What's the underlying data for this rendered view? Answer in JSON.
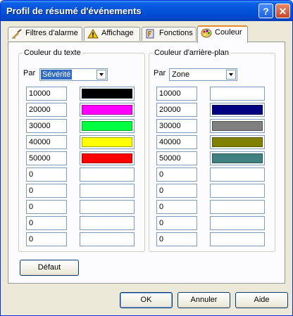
{
  "window": {
    "title": "Profil de résumé d'événements",
    "help_label": "?",
    "close_label": "✕"
  },
  "tabs": [
    {
      "label": "Filtres d'alarme",
      "icon": "filter-broom-icon",
      "active": false
    },
    {
      "label": "Affichage",
      "icon": "display-warning-icon",
      "active": false
    },
    {
      "label": "Fonctions",
      "icon": "functions-icon",
      "active": false
    },
    {
      "label": "Couleur",
      "icon": "palette-icon",
      "active": true
    }
  ],
  "text_color": {
    "title": "Couleur du texte",
    "par_label": "Par",
    "combo_value": "Sévérité",
    "rows": [
      {
        "value": "10000",
        "color": "#000000"
      },
      {
        "value": "20000",
        "color": "#ff00ff"
      },
      {
        "value": "30000",
        "color": "#00ff40"
      },
      {
        "value": "40000",
        "color": "#ffff00"
      },
      {
        "value": "50000",
        "color": "#ff0000"
      },
      {
        "value": "0",
        "color": ""
      },
      {
        "value": "0",
        "color": ""
      },
      {
        "value": "0",
        "color": ""
      },
      {
        "value": "0",
        "color": ""
      },
      {
        "value": "0",
        "color": ""
      }
    ]
  },
  "background_color": {
    "title": "Couleur d'arrière-plan",
    "par_label": "Par",
    "combo_value": "Zone",
    "rows": [
      {
        "value": "10000",
        "color": ""
      },
      {
        "value": "20000",
        "color": "#000080"
      },
      {
        "value": "30000",
        "color": "#808080"
      },
      {
        "value": "40000",
        "color": "#808000"
      },
      {
        "value": "50000",
        "color": "#408080"
      },
      {
        "value": "0",
        "color": ""
      },
      {
        "value": "0",
        "color": ""
      },
      {
        "value": "0",
        "color": ""
      },
      {
        "value": "0",
        "color": ""
      },
      {
        "value": "0",
        "color": ""
      }
    ]
  },
  "buttons": {
    "default_label": "Défaut",
    "ok_label": "OK",
    "cancel_label": "Annuler",
    "help_label": "Aide"
  }
}
